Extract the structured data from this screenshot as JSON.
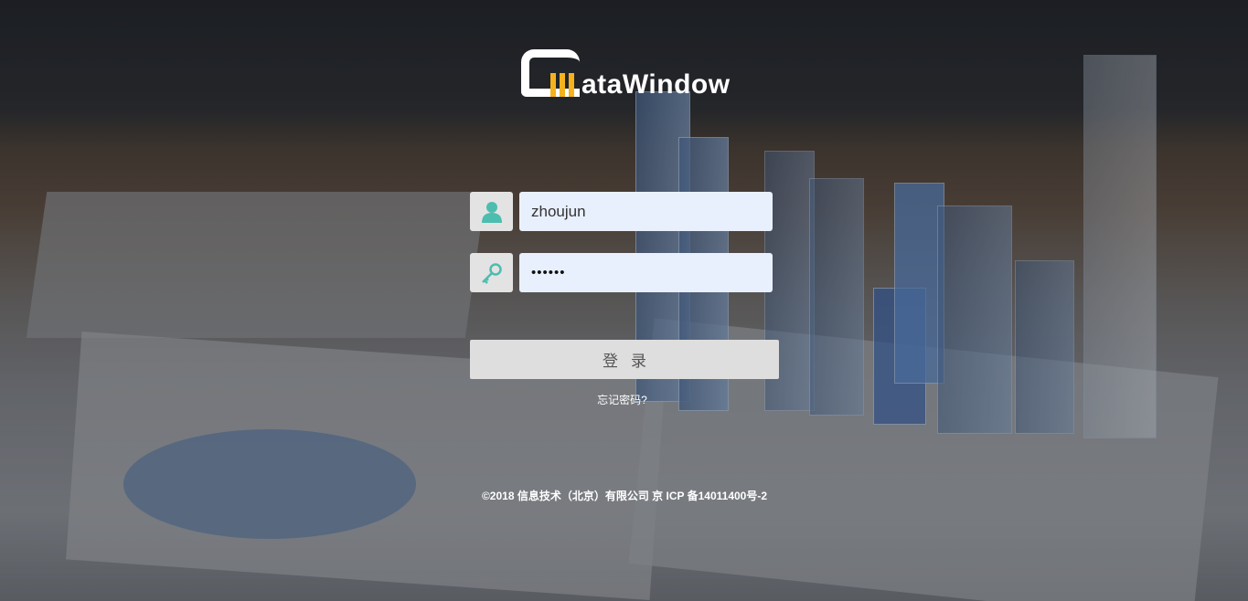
{
  "logo": {
    "text": "ataWindow",
    "full": "DataWindow"
  },
  "colors": {
    "accent": "#4dbdaf",
    "logo_yellow": "#f5b21e",
    "input_bg": "#e9f0fd",
    "button_bg": "#dedede"
  },
  "form": {
    "username": {
      "value": "zhoujun",
      "icon": "user-icon"
    },
    "password": {
      "value": "••••••",
      "icon": "key-icon"
    },
    "login_label": "登录",
    "forgot_label": "忘记密码?"
  },
  "footer": {
    "copyright": "©2018 信息技术（北京）有限公司 京 ICP 备14011400号-2"
  }
}
